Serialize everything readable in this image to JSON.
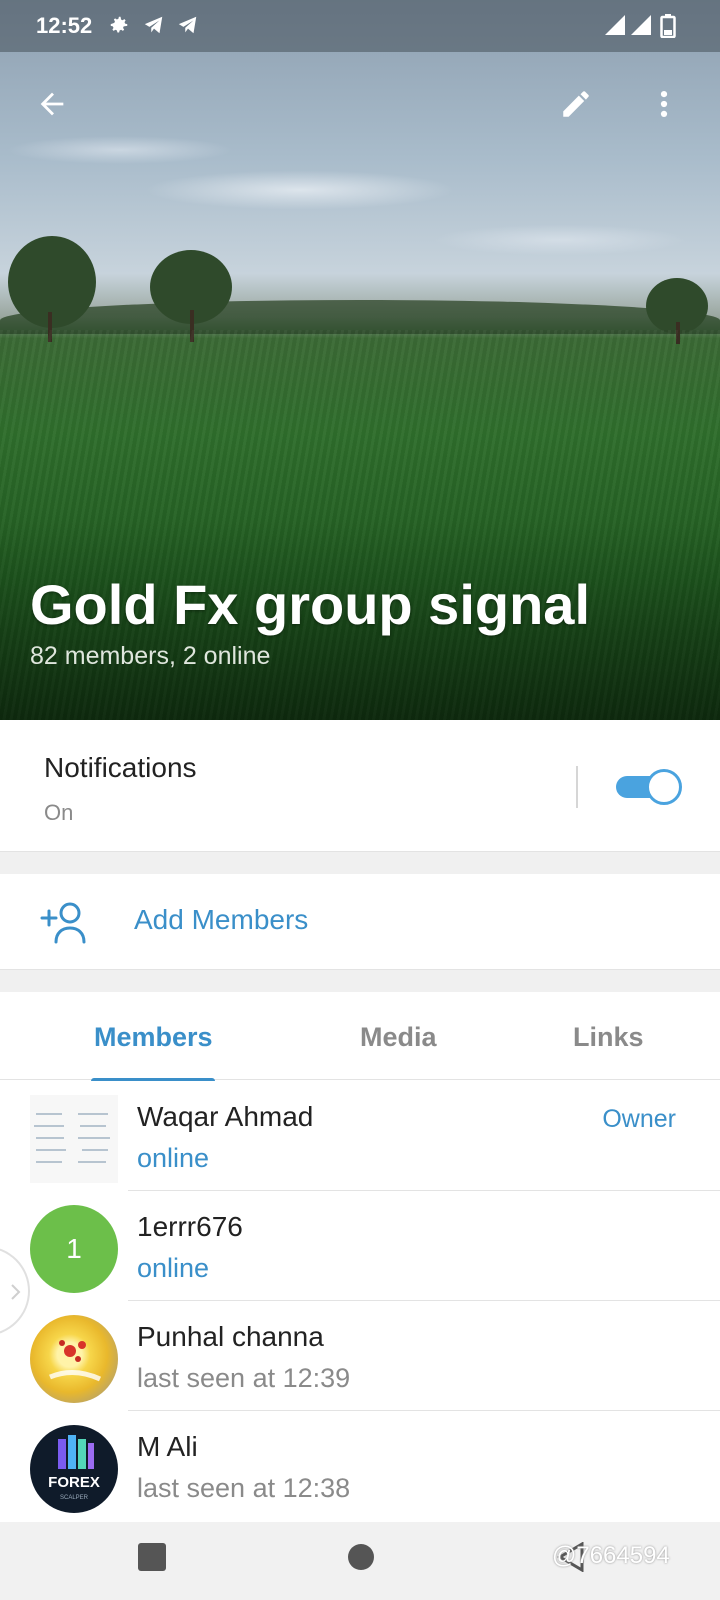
{
  "status_bar": {
    "time": "12:52",
    "icons": [
      "gear-icon",
      "telegram-icon",
      "telegram-icon",
      "signal-icon",
      "signal-icon",
      "battery-icon"
    ]
  },
  "header": {
    "title": "Gold Fx group signal",
    "subtitle": "82 members, 2 online",
    "actions": [
      "back-arrow-icon",
      "edit-pencil-icon",
      "more-vert-icon"
    ]
  },
  "notifications": {
    "label": "Notifications",
    "value": "On",
    "enabled": true
  },
  "add_members": {
    "label": "Add Members",
    "icon": "add-user-icon"
  },
  "tabs": [
    {
      "label": "Members",
      "active": true
    },
    {
      "label": "Media",
      "active": false
    },
    {
      "label": "Links",
      "active": false
    }
  ],
  "members": [
    {
      "name": "Waqar Ahmad",
      "status": "online",
      "role": "Owner",
      "avatar": "document-avatar"
    },
    {
      "name": "1errr676",
      "status": "online",
      "role": "",
      "avatar": "letter-avatar",
      "initial": "1"
    },
    {
      "name": "Punhal channa",
      "status": "last seen at 12:39",
      "role": "",
      "avatar": "flower-avatar"
    },
    {
      "name": "M Ali",
      "status": "last seen at 12:38",
      "role": "",
      "avatar": "forex-avatar",
      "avatar_text": "FOREX",
      "avatar_subtext": "SCALPER"
    }
  ],
  "colors": {
    "accent": "#3a8fc9",
    "toggle": "#4aa3df",
    "letter_avatar": "#6cbf4a"
  },
  "watermark": "@7664594"
}
